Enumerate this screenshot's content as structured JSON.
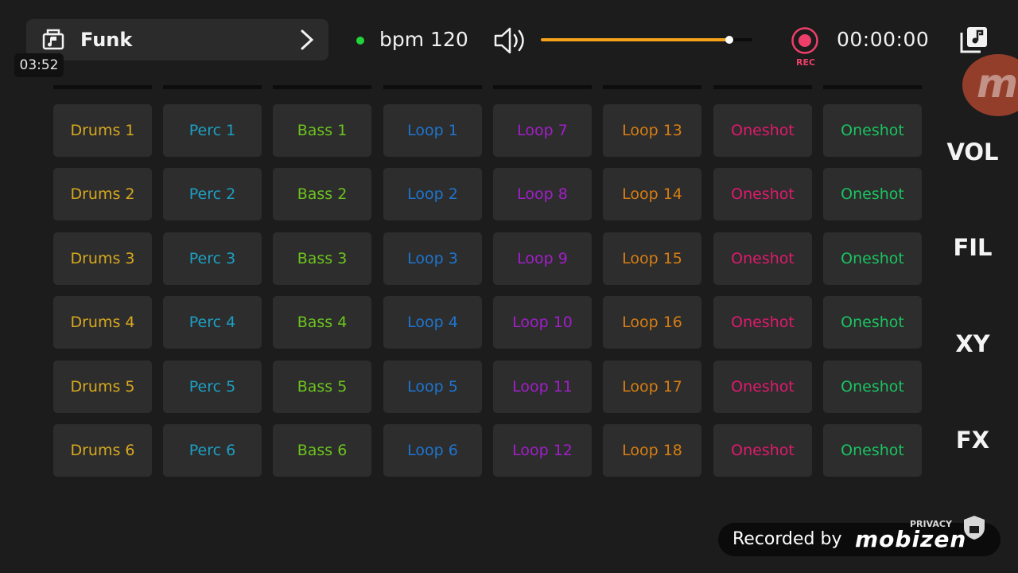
{
  "topbar": {
    "genre": "Funk",
    "bpm": "bpm 120",
    "volume_level": 0.89,
    "rec_label": "REC",
    "timer": "00:00:00"
  },
  "clock": "03:52",
  "pads": [
    [
      "Drums 1",
      "Perc 1",
      "Bass 1",
      "Loop 1",
      "Loop 7",
      "Loop 13",
      "Oneshot",
      "Oneshot"
    ],
    [
      "Drums 2",
      "Perc 2",
      "Bass 2",
      "Loop 2",
      "Loop 8",
      "Loop 14",
      "Oneshot",
      "Oneshot"
    ],
    [
      "Drums 3",
      "Perc 3",
      "Bass 3",
      "Loop 3",
      "Loop 9",
      "Loop 15",
      "Oneshot",
      "Oneshot"
    ],
    [
      "Drums 4",
      "Perc 4",
      "Bass 4",
      "Loop 4",
      "Loop 10",
      "Loop 16",
      "Oneshot",
      "Oneshot"
    ],
    [
      "Drums 5",
      "Perc 5",
      "Bass 5",
      "Loop 5",
      "Loop 11",
      "Loop 17",
      "Oneshot",
      "Oneshot"
    ],
    [
      "Drums 6",
      "Perc 6",
      "Bass 6",
      "Loop 6",
      "Loop 12",
      "Loop 18",
      "Oneshot",
      "Oneshot"
    ]
  ],
  "column_colors": [
    "#d9a81f",
    "#1e9fc3",
    "#6cc31f",
    "#1f74cf",
    "#a21ec9",
    "#d77d14",
    "#e0196f",
    "#1cc262"
  ],
  "side_buttons": [
    "VOL",
    "FIL",
    "XY",
    "FX"
  ],
  "watermark": {
    "recorded_by": "Recorded by",
    "brand": "mobizen",
    "privacy": "PRIVACY"
  }
}
